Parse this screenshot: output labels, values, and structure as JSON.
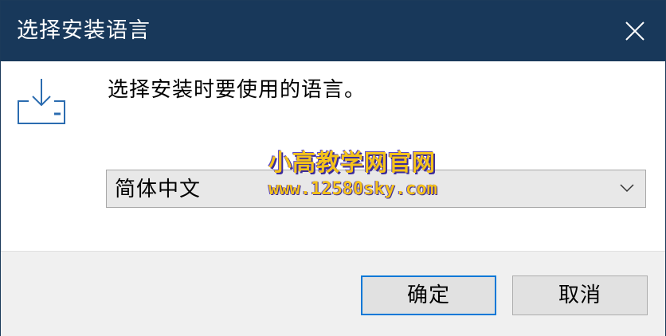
{
  "window": {
    "title": "选择安装语言",
    "close_icon": "close-icon"
  },
  "content": {
    "icon": "install-download-icon",
    "prompt": "选择安装时要使用的语言。"
  },
  "language_select": {
    "selected": "简体中文",
    "arrow_icon": "chevron-down-icon"
  },
  "watermark": {
    "line1": "小高教学网官网",
    "line2": "www.12580sky.com"
  },
  "buttons": {
    "ok": "确定",
    "cancel": "取消"
  },
  "colors": {
    "titlebar": "#18385a",
    "accent": "#0078d7",
    "watermark": "#f4c21a"
  }
}
